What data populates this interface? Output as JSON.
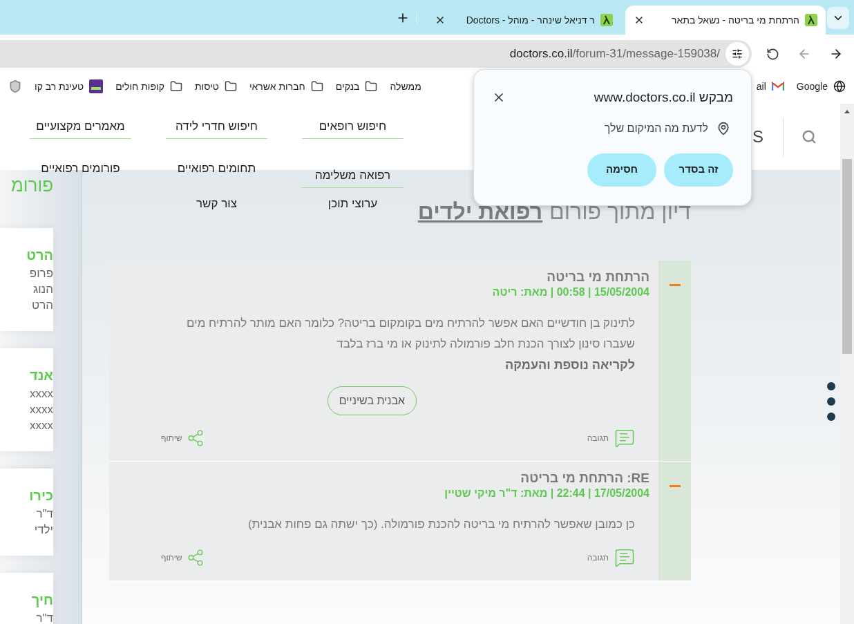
{
  "browser": {
    "tabs": [
      {
        "title": "הרתחת מי בריטה - נשאל בתאר",
        "selected": true
      },
      {
        "title": "ר דניאל שינהר - מוהל - Doctors",
        "selected": false
      }
    ],
    "address_bar": {
      "host": "doctors.co.il",
      "path": "/forum-31/message-159038/"
    },
    "bookmarks": [
      {
        "label": "Google",
        "kind": "globe"
      },
      {
        "label": "ail",
        "kind": "gmail"
      },
      {
        "label": "ממשלה",
        "kind": "hidden"
      },
      {
        "label": "בנקים",
        "kind": "folder"
      },
      {
        "label": "חברות אשראי",
        "kind": "folder"
      },
      {
        "label": "טיסות",
        "kind": "folder"
      },
      {
        "label": "קופות חולים",
        "kind": "folder"
      },
      {
        "label": "טעינת רב קו",
        "kind": "card"
      }
    ]
  },
  "permission_popup": {
    "title": "מבקש www.doctors.co.il",
    "permission": "לדעת מה המיקום שלך",
    "buttons": [
      "זה בסדר",
      "חסימה"
    ]
  },
  "site": {
    "logo_fragment": "S",
    "nav": [
      [
        {
          "label": "חיפוש רופאים",
          "underlined": true
        },
        {
          "label": "רפואה משלימה",
          "underlined": true
        },
        {
          "label": "ערוצי תוכן",
          "underlined": false
        }
      ],
      [
        {
          "label": "חיפוש חדרי לידה",
          "underlined": true
        },
        {
          "label": "תחומים רפואיים",
          "underlined": false
        },
        {
          "label": "צור קשר",
          "underlined": false
        }
      ],
      [
        {
          "label": "מאמרים מקצועיים",
          "underlined": true
        },
        {
          "label": "פורומים רפואיים",
          "underlined": false
        }
      ]
    ],
    "sidebar": {
      "title": "פורומ",
      "cards": [
        {
          "title": "הרט",
          "lines": [
            "פרופ",
            "הנוג",
            "הרט"
          ]
        },
        {
          "title": "אנד",
          "lines": [
            "xxxx",
            "xxxx",
            "xxxx"
          ]
        },
        {
          "title": "כירו",
          "lines": [
            "ד\"ר",
            "ילדי"
          ]
        },
        {
          "title": "חיך",
          "lines": [
            "ד\"ר"
          ]
        }
      ]
    },
    "heading": {
      "text": "דיון מתוך פורום",
      "forum_link": "רפואת ילדים"
    },
    "posts": [
      {
        "title": "הרתחת מי בריטה",
        "meta": "15/05/2004 | 00:58 | מאת: ריטה",
        "body": "לתינוק בן חודשיים האם אפשר להרתיח מים בקומקום בריטה? כלומר האם מותר להרתיח מים שעברו סינון לצורך הכנת חלב פורמולה לתינוק או מי ברז בלבד",
        "more_link": "לקריאה נוספת והעמקה",
        "tags": [
          "אבנית בשיניים"
        ],
        "reply": "תגובה",
        "share": "שיתוף",
        "expanded": true
      },
      {
        "title": "RE: הרתחת מי בריטה",
        "meta": "17/05/2004 | 22:44 | מאת: ד\"ר מיקי שטיין",
        "body": "כן כמובן שאפשר להרתיח מי בריטה להכנת פורמולה. (כך ישתה גם פחות אבנית)",
        "reply": "תגובה",
        "share": "שיתוף",
        "expanded": true
      }
    ]
  }
}
